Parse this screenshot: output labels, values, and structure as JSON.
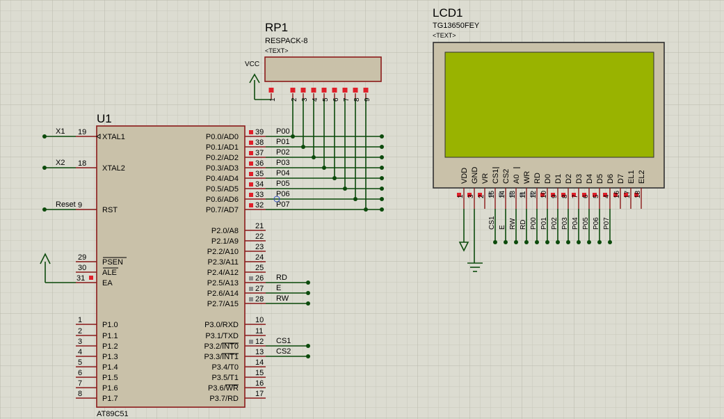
{
  "colors": {
    "background": "#dcdcd1",
    "grid": "#c3c3b5",
    "body": "#c9c1a9",
    "outline": "#8b1a1a",
    "wire": "#0c4a0c",
    "lcd_screen": "#99b300",
    "pin_red": "#e0202a",
    "pin_grey": "#8a8a8a"
  },
  "mcu": {
    "ref": "U1",
    "part": "AT89C51",
    "left_pins": [
      {
        "num": "19",
        "name": "XTAL1",
        "net": "X1"
      },
      {
        "num": "18",
        "name": "XTAL2",
        "net": "X2"
      },
      {
        "num": "9",
        "name": "RST",
        "net": "Reset"
      },
      {
        "num": "29",
        "name": "PSEN",
        "net": ""
      },
      {
        "num": "30",
        "name": "ALE",
        "net": ""
      },
      {
        "num": "31",
        "name": "EA",
        "net": ""
      },
      {
        "num": "1",
        "name": "P1.0",
        "net": ""
      },
      {
        "num": "2",
        "name": "P1.1",
        "net": ""
      },
      {
        "num": "3",
        "name": "P1.2",
        "net": ""
      },
      {
        "num": "4",
        "name": "P1.3",
        "net": ""
      },
      {
        "num": "5",
        "name": "P1.4",
        "net": ""
      },
      {
        "num": "6",
        "name": "P1.5",
        "net": ""
      },
      {
        "num": "7",
        "name": "P1.6",
        "net": ""
      },
      {
        "num": "8",
        "name": "P1.7",
        "net": ""
      }
    ],
    "right_pins": [
      {
        "num": "39",
        "name": "P0.0/AD0",
        "net": "P00"
      },
      {
        "num": "38",
        "name": "P0.1/AD1",
        "net": "P01"
      },
      {
        "num": "37",
        "name": "P0.2/AD2",
        "net": "P02"
      },
      {
        "num": "36",
        "name": "P0.3/AD3",
        "net": "P03"
      },
      {
        "num": "35",
        "name": "P0.4/AD4",
        "net": "P04"
      },
      {
        "num": "34",
        "name": "P0.5/AD5",
        "net": "P05"
      },
      {
        "num": "33",
        "name": "P0.6/AD6",
        "net": "P06"
      },
      {
        "num": "32",
        "name": "P0.7/AD7",
        "net": "P07"
      },
      {
        "num": "21",
        "name": "P2.0/A8",
        "net": ""
      },
      {
        "num": "22",
        "name": "P2.1/A9",
        "net": ""
      },
      {
        "num": "23",
        "name": "P2.2/A10",
        "net": ""
      },
      {
        "num": "24",
        "name": "P2.3/A11",
        "net": ""
      },
      {
        "num": "25",
        "name": "P2.4/A12",
        "net": ""
      },
      {
        "num": "26",
        "name": "P2.5/A13",
        "net": "RD"
      },
      {
        "num": "27",
        "name": "P2.6/A14",
        "net": "E"
      },
      {
        "num": "28",
        "name": "P2.7/A15",
        "net": "RW"
      },
      {
        "num": "10",
        "name": "P3.0/RXD",
        "net": ""
      },
      {
        "num": "11",
        "name": "P3.1/TXD",
        "net": ""
      },
      {
        "num": "12",
        "name": "P3.2/INT0",
        "net": "CS1"
      },
      {
        "num": "13",
        "name": "P3.3/INT1",
        "net": "CS2"
      },
      {
        "num": "14",
        "name": "P3.4/T0",
        "net": ""
      },
      {
        "num": "15",
        "name": "P3.5/T1",
        "net": ""
      },
      {
        "num": "16",
        "name": "P3.6/WR",
        "net": ""
      },
      {
        "num": "17",
        "name": "P3.7/RD",
        "net": ""
      }
    ]
  },
  "rpack": {
    "ref": "RP1",
    "part": "RESPACK-8",
    "text": "<TEXT>",
    "vcc": "VCC",
    "pins": [
      "1",
      "2",
      "3",
      "4",
      "5",
      "6",
      "7",
      "8",
      "9"
    ]
  },
  "lcd": {
    "ref": "LCD1",
    "part": "TG13650FEY",
    "text": "<TEXT>",
    "pins": [
      {
        "num": "1",
        "name": "VDD",
        "net": ""
      },
      {
        "num": "3",
        "name": "GND",
        "net": ""
      },
      {
        "num": "2",
        "name": "VR",
        "net": ""
      },
      {
        "num": "15",
        "name": "CS1",
        "net": "CS1"
      },
      {
        "num": "14",
        "name": "CS2",
        "net": "E"
      },
      {
        "num": "13",
        "name": "A0",
        "net": "RW"
      },
      {
        "num": "11",
        "name": "WR",
        "net": "RD"
      },
      {
        "num": "12",
        "name": "RD",
        "net": "P00"
      },
      {
        "num": "10",
        "name": "D0",
        "net": "P01"
      },
      {
        "num": "9",
        "name": "D1",
        "net": "P02"
      },
      {
        "num": "8",
        "name": "D2",
        "net": "P03"
      },
      {
        "num": "7",
        "name": "D3",
        "net": "P04"
      },
      {
        "num": "6",
        "name": "D4",
        "net": "P05"
      },
      {
        "num": "5",
        "name": "D5",
        "net": "P06"
      },
      {
        "num": "4",
        "name": "D6",
        "net": "P07"
      },
      {
        "num": "16",
        "name": "D7",
        "net": ""
      },
      {
        "num": "17",
        "name": "EL1",
        "net": ""
      },
      {
        "num": "18",
        "name": "EL2",
        "net": ""
      }
    ]
  }
}
